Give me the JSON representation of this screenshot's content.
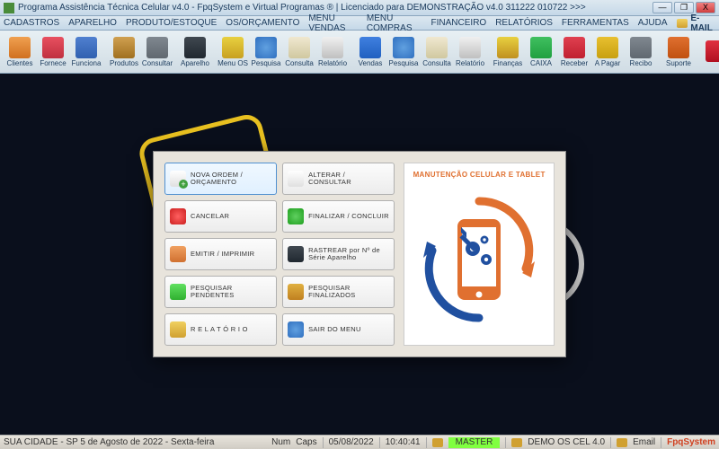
{
  "titlebar": {
    "text": "Programa Assistência Técnica Celular v4.0 - FpqSystem e Virtual Programas ® | Licenciado para  DEMONSTRAÇÃO v4.0 311222 010722  >>>"
  },
  "winControls": {
    "min": "—",
    "max": "❐",
    "close": "X"
  },
  "menubar": {
    "items": [
      "CADASTROS",
      "APARELHO",
      "PRODUTO/ESTOQUE",
      "OS/ORÇAMENTO",
      "MENU VENDAS",
      "MENU COMPRAS",
      "FINANCEIRO",
      "RELATÓRIOS",
      "FERRAMENTAS",
      "AJUDA"
    ],
    "email": "E-MAIL"
  },
  "toolbar": {
    "groups": [
      [
        {
          "k": "clientes",
          "l": "Clientes"
        },
        {
          "k": "fornece",
          "l": "Fornece"
        },
        {
          "k": "funciona",
          "l": "Funciona"
        }
      ],
      [
        {
          "k": "produtos",
          "l": "Produtos"
        },
        {
          "k": "consultar",
          "l": "Consultar"
        }
      ],
      [
        {
          "k": "aparelho",
          "l": "Aparelho"
        }
      ],
      [
        {
          "k": "menuos",
          "l": "Menu OS"
        },
        {
          "k": "pesquisa",
          "l": "Pesquisa"
        },
        {
          "k": "consulta",
          "l": "Consulta"
        },
        {
          "k": "relatorio",
          "l": "Relatório"
        }
      ],
      [
        {
          "k": "vendas",
          "l": "Vendas"
        },
        {
          "k": "pesquisa",
          "l": "Pesquisa"
        },
        {
          "k": "consulta",
          "l": "Consulta"
        },
        {
          "k": "relatorio",
          "l": "Relatório"
        }
      ],
      [
        {
          "k": "financas",
          "l": "Finanças"
        },
        {
          "k": "caixa",
          "l": "CAIXA"
        },
        {
          "k": "receber",
          "l": "Receber"
        },
        {
          "k": "pagar",
          "l": "A Pagar"
        },
        {
          "k": "recibo",
          "l": "Recibo"
        }
      ],
      [
        {
          "k": "suporte",
          "l": "Suporte"
        }
      ],
      [
        {
          "k": "sair",
          "l": ""
        }
      ]
    ]
  },
  "dialog": {
    "title": "MANUTENÇÃO CELULAR E TABLET",
    "rows": [
      [
        {
          "k": "new",
          "t": "NOVA ORDEM / ORÇAMENTO",
          "sel": true
        },
        {
          "k": "edit",
          "t": "ALTERAR  /  CONSULTAR"
        }
      ],
      [
        {
          "k": "cancel",
          "t": "CANCELAR"
        },
        {
          "k": "final",
          "t": "FINALIZAR  /  CONCLUIR"
        }
      ],
      [
        {
          "k": "print",
          "t": "EMITIR  /  IMPRIMIR"
        },
        {
          "k": "track",
          "t": "RASTREAR por Nº de Série Aparelho"
        }
      ],
      [
        {
          "k": "pend",
          "t": "PESQUISAR PENDENTES"
        },
        {
          "k": "done",
          "t": "PESQUISAR FINALIZADOS"
        }
      ],
      [
        {
          "k": "rel",
          "t": "R E L A T Ó R I O"
        },
        {
          "k": "exit",
          "t": "SAIR DO MENU"
        }
      ]
    ]
  },
  "statusbar": {
    "location": "SUA CIDADE - SP  5 de Agosto de 2022 - Sexta-feira",
    "num": "Num",
    "caps": "Caps",
    "date": "05/08/2022",
    "time": "10:40:41",
    "user": "MASTER",
    "db": "DEMO OS CEL 4.0",
    "email": "Email",
    "brand": "FpqSystem"
  }
}
